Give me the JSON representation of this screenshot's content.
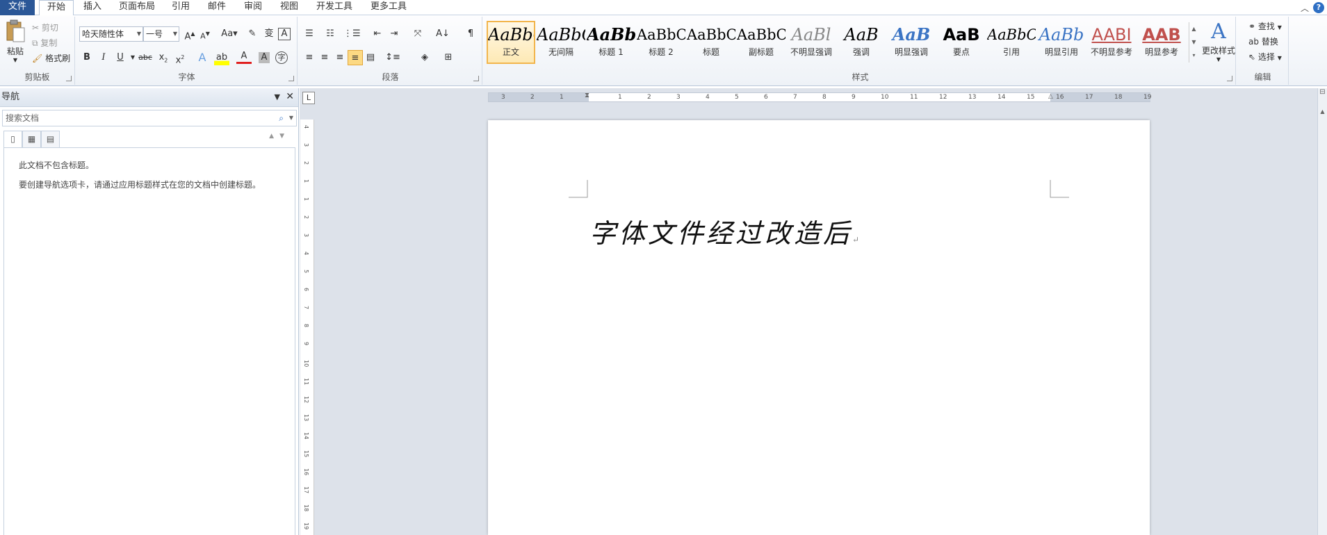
{
  "tabs": [
    "文件",
    "开始",
    "插入",
    "页面布局",
    "引用",
    "邮件",
    "审阅",
    "视图",
    "开发工具",
    "更多工具"
  ],
  "clipboard": {
    "label": "剪贴板",
    "paste": "粘贴",
    "cut": "剪切",
    "copy": "复制",
    "format_painter": "格式刷"
  },
  "font": {
    "label": "字体",
    "name": "哈天随性体",
    "size": "一号"
  },
  "paragraph": {
    "label": "段落"
  },
  "styles": {
    "label": "样式",
    "items": [
      {
        "preview": "AaBbCc",
        "name": "正文"
      },
      {
        "preview": "AaBbCc",
        "name": "无间隔"
      },
      {
        "preview": "AaBb(",
        "name": "标题 1"
      },
      {
        "preview": "AaBbC",
        "name": "标题 2"
      },
      {
        "preview": "AaBbC",
        "name": "标题"
      },
      {
        "preview": "AaBbC",
        "name": "副标题"
      },
      {
        "preview": "AaBl",
        "name": "不明显强调"
      },
      {
        "preview": "AaB",
        "name": "强调"
      },
      {
        "preview": "AaB",
        "name": "明显强调"
      },
      {
        "preview": "AaB",
        "name": "要点"
      },
      {
        "preview": "AaBbC",
        "name": "引用"
      },
      {
        "preview": "AaBb",
        "name": "明显引用"
      },
      {
        "preview": "AABI",
        "name": "不明显参考"
      },
      {
        "preview": "AAB",
        "name": "明显参考"
      }
    ],
    "change_styles": "更改样式"
  },
  "editing": {
    "label": "编辑",
    "find": "查找",
    "replace": "替换",
    "select": "选择"
  },
  "nav": {
    "title": "导航",
    "search_placeholder": "搜索文档",
    "msg1": "此文档不包含标题。",
    "msg2": "要创建导航选项卡，请通过应用标题样式在您的文档中创建标题。"
  },
  "ruler_numbers": [
    "3",
    "2",
    "1",
    "1",
    "2",
    "3",
    "4",
    "5",
    "6",
    "7",
    "8",
    "9",
    "10",
    "11",
    "12",
    "13",
    "14",
    "15",
    "16",
    "17",
    "18",
    "19"
  ],
  "vruler_numbers": [
    "4",
    "3",
    "2",
    "1",
    "1",
    "2",
    "3",
    "4",
    "5",
    "6",
    "7",
    "8",
    "9",
    "10",
    "11",
    "12",
    "13",
    "14",
    "15",
    "16",
    "17",
    "18",
    "19"
  ],
  "document": {
    "text": "字体文件经过改造后"
  },
  "colors": {
    "file_tab": "#2b5797",
    "selected_style": "#f2b54c"
  }
}
